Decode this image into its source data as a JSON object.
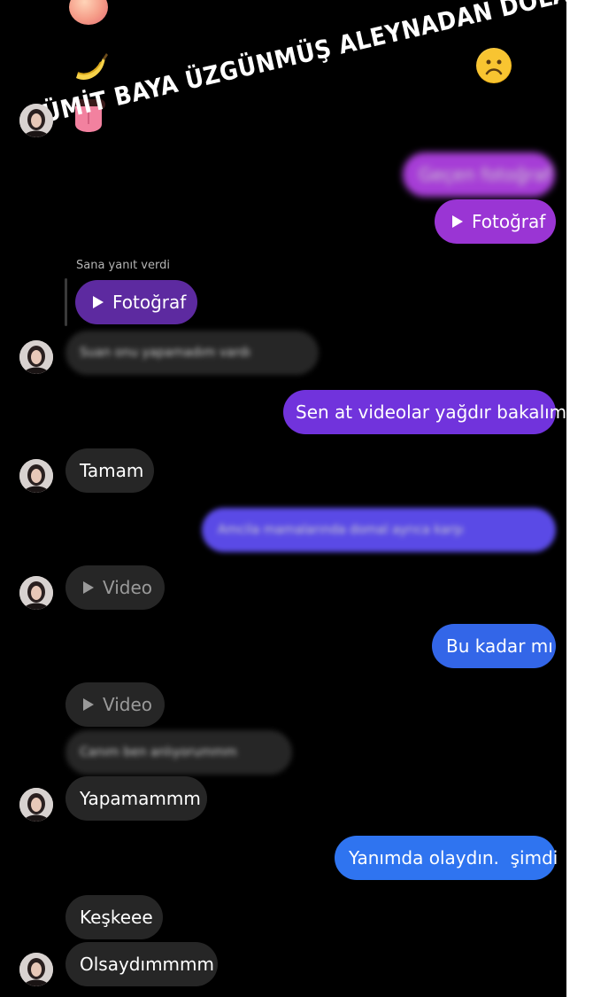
{
  "caption": {
    "text": "ÜMİT BAYA ÜZGÜNMÜŞ ALEYNADAN DOLAYI",
    "emoji": "sad-face"
  },
  "top_emojis": [
    "peach",
    "banana",
    "tongue"
  ],
  "reply_label": "Sana yanıt verdi",
  "colors": {
    "background": "#000000",
    "incoming": "#262626",
    "outgoing_purple": "#7b35d8",
    "outgoing_blue": "#2f6ff0"
  },
  "messages": [
    {
      "side": "out",
      "text": "Geçen fotoğraf",
      "blurred": true
    },
    {
      "side": "out",
      "type": "media",
      "text": "Fotoğraf"
    },
    {
      "side": "in",
      "type": "media",
      "text": "Fotoğraf",
      "reply": true
    },
    {
      "side": "in",
      "text": "Suan onu yapamadım vardı",
      "blurred": true
    },
    {
      "side": "out",
      "text": "Sen at videolar yağdır bakalım"
    },
    {
      "side": "in",
      "text": "Tamam"
    },
    {
      "side": "out",
      "text": "Amcila mamalarında domal ayrıca karşı",
      "blurred": true
    },
    {
      "side": "in",
      "type": "media",
      "text": "Video"
    },
    {
      "side": "out",
      "text": "Bu kadar mı"
    },
    {
      "side": "in",
      "type": "media",
      "text": "Video"
    },
    {
      "side": "in",
      "text": "Canım ben anlıyorummm",
      "blurred": true
    },
    {
      "side": "in",
      "text": "Yapamammm"
    },
    {
      "side": "out",
      "text": "Yanımda olaydın.  şimdi"
    },
    {
      "side": "in",
      "text": "Keşkeee"
    },
    {
      "side": "in",
      "text": "Olsaydımmmm"
    }
  ]
}
